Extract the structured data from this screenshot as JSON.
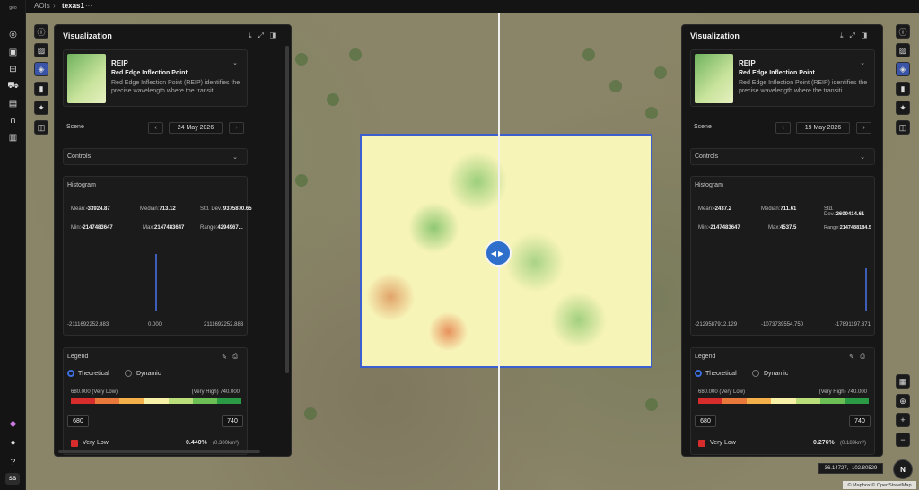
{
  "breadcrumb": {
    "root": "AOIs",
    "current": "texas1",
    "more": "···"
  },
  "nav": {
    "logo": "geo",
    "user_initials": "SB"
  },
  "panels": [
    {
      "title": "Visualization",
      "index": {
        "name": "REIP",
        "full_name": "Red Edge Inflection Point",
        "description": "Red Edge Inflection Point (REIP) identifies the precise wavelength where the transiti..."
      },
      "scene_label": "Scene",
      "scene_date": "24 May 2026",
      "controls_label": "Controls",
      "histogram_label": "Histogram",
      "stats": {
        "mean_label": "Mean:",
        "mean": "-33924.87",
        "median_label": "Median:",
        "median": "713.12",
        "std_label": "Std. Dev.:",
        "std": "9375870.65",
        "min_label": "Min:",
        "min": "-2147483647",
        "max_label": "Max:",
        "max": "2147483647",
        "range_label": "Range:",
        "range": "4294967..."
      },
      "hist_axis": [
        "-2111692252.883",
        "0.000",
        "2111692252.883"
      ],
      "hist_bar_fraction": 0.32,
      "legend_label": "Legend",
      "mode_theoretical": "Theoretical",
      "mode_dynamic": "Dynamic",
      "ramp_low": "680.000 (Very Low)",
      "ramp_high": "(Very High) 740.000",
      "min_value": "680",
      "max_value": "740",
      "row_label": "Very Low",
      "row_percent": "0.440%",
      "row_area": "(0.300km²)"
    },
    {
      "title": "Visualization",
      "index": {
        "name": "REIP",
        "full_name": "Red Edge Inflection Point",
        "description": "Red Edge Inflection Point (REIP) identifies the precise wavelength where the transiti..."
      },
      "scene_label": "Scene",
      "scene_date": "19 May 2026",
      "controls_label": "Controls",
      "histogram_label": "Histogram",
      "stats": {
        "mean_label": "Mean:",
        "mean": "-2437.2",
        "median_label": "Median:",
        "median": "711.61",
        "std_label": "Std. Dev.:",
        "std": "2600414.61",
        "min_label": "Min:",
        "min": "-2147483647",
        "max_label": "Max:",
        "max": "4537.5",
        "range_label": "Range:",
        "range": "2147488184.5"
      },
      "hist_axis": [
        "-2129587912.129",
        "-1073739554.750",
        "-17891197.371"
      ],
      "hist_bar_fraction": 0.24,
      "legend_label": "Legend",
      "mode_theoretical": "Theoretical",
      "mode_dynamic": "Dynamic",
      "ramp_low": "680.000 (Very Low)",
      "ramp_high": "(Very High) 740.000",
      "min_value": "680",
      "max_value": "740",
      "row_label": "Very Low",
      "row_percent": "0.276%",
      "row_area": "(0.189km²)"
    }
  ],
  "map": {
    "coordinates": "36.14727, -102.80529",
    "compass": "N",
    "attribution": "© Mapbox © OpenStreetMap"
  },
  "colors": {
    "accent": "#3b6fe0",
    "ramp": [
      "#d62c2c",
      "#e8793a",
      "#f3b04b",
      "#f6f1a6",
      "#b9de7a",
      "#6bbf55",
      "#2b9a45"
    ]
  }
}
